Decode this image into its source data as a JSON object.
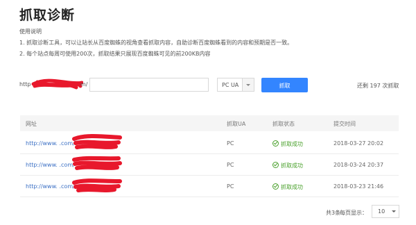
{
  "header": {
    "title": "抓取诊断"
  },
  "usage": {
    "label": "使用说明",
    "lines": [
      "1. 抓取诊断工具，可以让站长从百度蜘蛛的视角查看抓取内容，自助诊断百度蜘蛛看到的内容和预期是否一致。",
      "2. 每个站点每周可使用200次，抓取结果只展现百度蜘蛛可见的前200KB内容"
    ]
  },
  "form": {
    "url_prefix": "http",
    "url_suffix": "m/",
    "path_value": "",
    "ua_value": "PC UA",
    "fetch_label": "抓取",
    "remaining_text": "还剩 197 次抓取"
  },
  "table": {
    "headers": [
      "网址",
      "抓取UA",
      "抓取状态",
      "提交时间"
    ],
    "rows": [
      {
        "url": "http://www.                    .com/",
        "ua": "PC",
        "status": "抓取成功",
        "time": "2018-03-27 20:02"
      },
      {
        "url": "http://www.                    .com/",
        "ua": "PC",
        "status": "抓取成功",
        "time": "2018-03-24 20:37"
      },
      {
        "url": "http://www.                    .com/",
        "ua": "PC",
        "status": "抓取成功",
        "time": "2018-03-23 21:46"
      }
    ]
  },
  "pagination": {
    "total_text": "共3条",
    "page_size_label": "每页显示：",
    "page_size_value": "10"
  },
  "colors": {
    "accent": "#3385ff",
    "success": "#4aa12c",
    "link": "#3a6fc4",
    "redaction": "#e8182c"
  }
}
